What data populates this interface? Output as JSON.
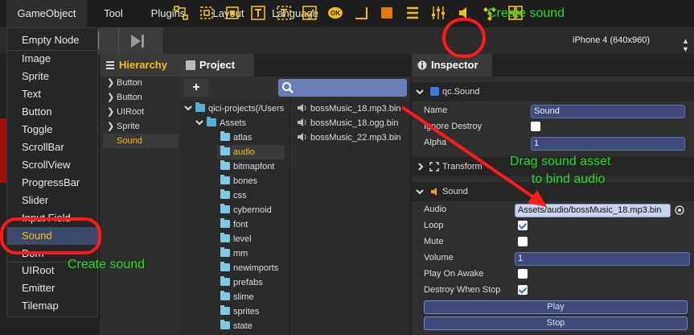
{
  "menubar": {
    "items": [
      {
        "label": "GameObject"
      },
      {
        "label": "Tool"
      },
      {
        "label": "Plugins"
      },
      {
        "label": "Layout"
      },
      {
        "label": "Language"
      }
    ]
  },
  "toolbar": {
    "device": "iPhone 4 (640x960)"
  },
  "gameobject_menu": {
    "items": [
      {
        "label": "Empty Node"
      },
      {
        "label": "Image"
      },
      {
        "label": "Sprite"
      },
      {
        "label": "Text"
      },
      {
        "label": "Button"
      },
      {
        "label": "Toggle"
      },
      {
        "label": "ScrollBar"
      },
      {
        "label": "ScrollView"
      },
      {
        "label": "ProgressBar"
      },
      {
        "label": "Slider"
      },
      {
        "label": "Input Field"
      },
      {
        "label": "Sound"
      },
      {
        "label": "Dom"
      },
      {
        "label": "UIRoot"
      },
      {
        "label": "Emitter"
      },
      {
        "label": "Tilemap"
      }
    ]
  },
  "hierarchy": {
    "title": "Hierarchy",
    "items": [
      {
        "label": "Button"
      },
      {
        "label": "Button"
      },
      {
        "label": "UIRoot"
      },
      {
        "label": "Sprite"
      },
      {
        "label": "Sound"
      }
    ]
  },
  "project": {
    "title": "Project",
    "add_label": "+",
    "root": "qici-projects(/Users",
    "assets": "Assets",
    "folders": [
      {
        "label": "atlas"
      },
      {
        "label": "audio"
      },
      {
        "label": "bitmapfont"
      },
      {
        "label": "bones"
      },
      {
        "label": "css"
      },
      {
        "label": "cybernoid"
      },
      {
        "label": "font"
      },
      {
        "label": "level"
      },
      {
        "label": "mm"
      },
      {
        "label": "newimports"
      },
      {
        "label": "prefabs"
      },
      {
        "label": "slime"
      },
      {
        "label": "sprites"
      },
      {
        "label": "state"
      }
    ],
    "files": [
      {
        "label": "bossMusic_18.mp3.bin"
      },
      {
        "label": "bossMusic_18.ogg.bin"
      },
      {
        "label": "bossMusic_22.mp3.bin"
      }
    ]
  },
  "inspector": {
    "title": "Inspector",
    "node_header": "qc.Sound",
    "name_label": "Name",
    "name_value": "Sound",
    "ignore_label": "Ignore Destroy",
    "alpha_label": "Alpha",
    "alpha_value": "1",
    "transform_label": "Transform",
    "sound_label": "Sound",
    "audio_label": "Audio",
    "audio_value": "Assets/audio/bossMusic_18.mp3.bin",
    "loop_label": "Loop",
    "mute_label": "Mute",
    "volume_label": "Volume",
    "volume_value": "1",
    "playonawake_label": "Play On Awake",
    "destroywhenstop_label": "Destroy When Stop",
    "play_label": "Play",
    "stop_label": "Stop"
  },
  "annotations": {
    "create_sound_top": "Create sound",
    "create_sound_left": "Create sound",
    "drag_line1": "Drag sound asset",
    "drag_line2": "to bind audio"
  },
  "colors": {
    "accent": "#f4c100",
    "annotation": "#22dd22",
    "highlight": "#ff1a1a"
  }
}
